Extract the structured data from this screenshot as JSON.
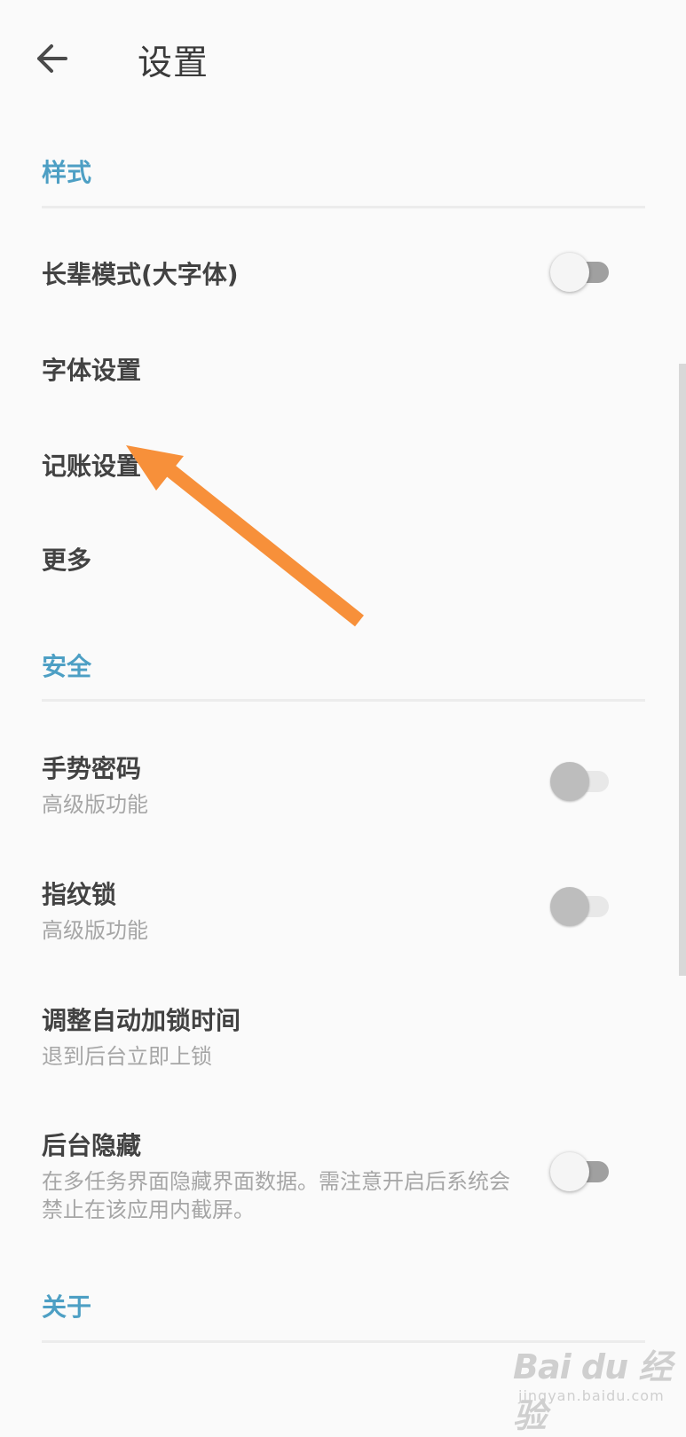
{
  "header": {
    "title": "设置"
  },
  "sections": {
    "style": {
      "header": "样式",
      "elder_mode": {
        "title": "长辈模式(大字体)",
        "enabled": false
      },
      "font_settings": {
        "title": "字体设置"
      },
      "bookkeeping_settings": {
        "title": "记账设置"
      },
      "more": {
        "title": "更多"
      }
    },
    "security": {
      "header": "安全",
      "gesture_password": {
        "title": "手势密码",
        "subtitle": "高级版功能",
        "enabled": false
      },
      "fingerprint_lock": {
        "title": "指纹锁",
        "subtitle": "高级版功能",
        "enabled": false
      },
      "auto_lock_time": {
        "title": "调整自动加锁时间",
        "subtitle": "退到后台立即上锁"
      },
      "background_hide": {
        "title": "后台隐藏",
        "subtitle": "在多任务界面隐藏界面数据。需注意开启后系统会禁止在该应用内截屏。",
        "enabled": false
      }
    },
    "about": {
      "header": "关于"
    }
  },
  "watermark": {
    "logo": "Bai du 经验",
    "url": "jingyan.baidu.com"
  },
  "colors": {
    "accent": "#4d9fc4",
    "annotation_arrow": "#f7903a",
    "background": "#fafafa"
  },
  "icons": {
    "back": "arrow-left-icon",
    "annotation": "arrow-annotation-icon"
  }
}
